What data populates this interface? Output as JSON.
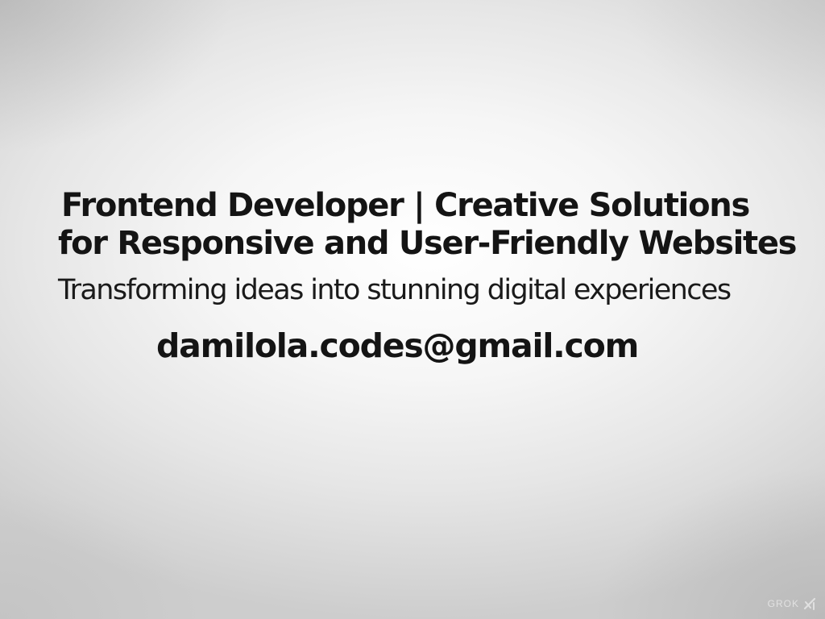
{
  "headline": {
    "line1": "Frontend Developer | Creative Solutions",
    "line2": "for Responsive and User-Friendly Websites"
  },
  "tagline": "Transforming ideas into stunning digital experiences",
  "email": "damilola.codes@gmail.com",
  "watermark": {
    "text": "GROK",
    "icon": "grok-logo-icon"
  },
  "colors": {
    "text": "#141414",
    "background_center": "#ffffff",
    "background_edge": "#cdcdcd"
  }
}
